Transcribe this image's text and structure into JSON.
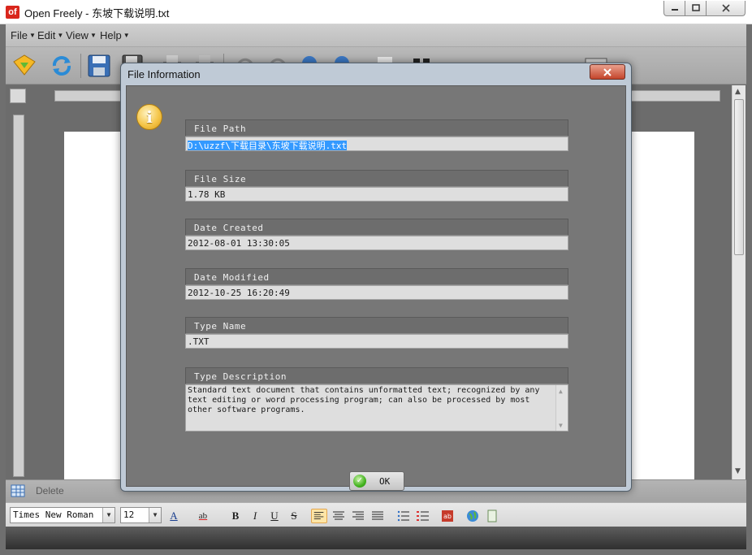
{
  "window": {
    "logo_text": "of",
    "title": "Open Freely - 东坡下载说明.txt"
  },
  "menu": {
    "items": [
      {
        "label": "File"
      },
      {
        "label": "Edit"
      },
      {
        "label": "View"
      },
      {
        "label": "Help"
      }
    ]
  },
  "toolbar": {
    "icons": [
      "open-icon",
      "refresh-icon",
      "save-icon",
      "save-as-icon",
      "print-icon",
      "print-preview-icon",
      "undo-icon",
      "redo-icon",
      "zoom-in-icon",
      "zoom-out-icon",
      "find-icon",
      "ebook-icon"
    ]
  },
  "table_toolbar": {
    "delete_label": "Delete"
  },
  "format_toolbar": {
    "font_name": "Times New Roman",
    "font_size": "12",
    "text_color_label": "A",
    "highlight_label": "ab",
    "bold_label": "B",
    "italic_label": "I",
    "underline_label": "U",
    "strike_label": "S"
  },
  "dialog": {
    "title": "File Information",
    "close_label": "x",
    "icon": "info-icon",
    "fields": {
      "file_path": {
        "label": "File Path",
        "value": "D:\\uzzf\\下载目录\\东坡下载说明.txt"
      },
      "file_size": {
        "label": "File Size",
        "value": "1.78 KB"
      },
      "date_created": {
        "label": "Date Created",
        "value": "2012-08-01 13:30:05"
      },
      "date_modified": {
        "label": "Date Modified",
        "value": "2012-10-25 16:20:49"
      },
      "type_name": {
        "label": "Type Name",
        "value": ".TXT"
      },
      "type_description": {
        "label": "Type Description",
        "line1": "Standard text document that contains unformatted text; recognized by any",
        "line2": "text editing or word processing program; can also be processed by most",
        "line3": "other software programs."
      }
    },
    "ok_label": "OK"
  },
  "colors": {
    "dialog_body": "#777777",
    "selection": "#3399ff",
    "close_button": "#c4452b"
  }
}
